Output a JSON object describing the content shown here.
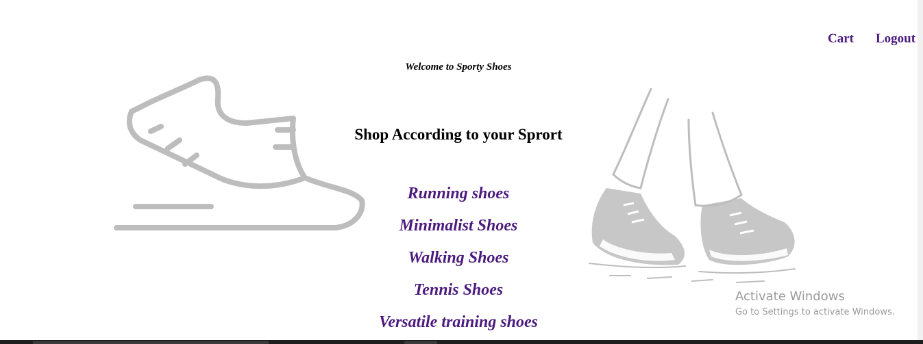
{
  "nav": {
    "cart_label": "Cart",
    "logout_label": "Logout"
  },
  "welcome_text": "Welcome to Sporty Shoes",
  "heading": "Shop According to your Sprort",
  "sports": [
    "Running shoes",
    "Minimalist Shoes",
    "Walking Shoes",
    "Tennis Shoes",
    "Versatile training shoes"
  ],
  "watermark": {
    "title": "Activate Windows",
    "subtitle": "Go to Settings to activate Windows."
  },
  "colors": {
    "link": "#4b1a7f",
    "illustration": "#bdbdbd",
    "watermark": "#9a9a9a"
  },
  "icons": {
    "left_illustration": "running-shoe-icon",
    "right_illustration": "walking-feet-illustration"
  }
}
